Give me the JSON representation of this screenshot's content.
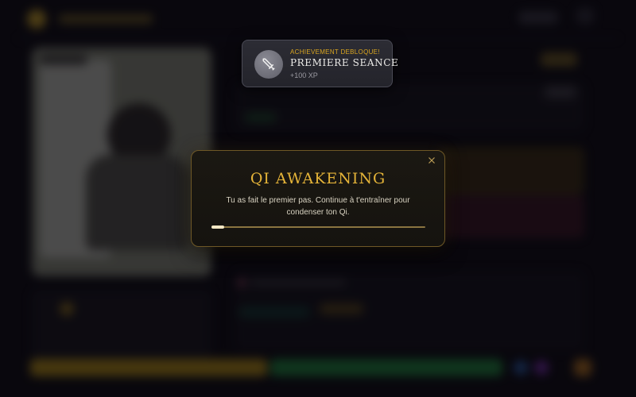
{
  "achievement_toast": {
    "kicker": "ACHIEVEMENT DEBLOQUE!",
    "title": "PREMIERE SEANCE",
    "xp": "+100 XP",
    "icon": "sword-icon"
  },
  "modal": {
    "title": "QI AWAKENING",
    "message": "Tu as fait le premier pas. Continue à t'entraîner pour condenser ton Qi.",
    "close_icon": "close-icon",
    "progress": 0.06
  },
  "colors": {
    "accent_gold": "#e4b338",
    "modal_border": "#6e5826",
    "toast_kicker": "#d9a520",
    "progress_track": "#8a7440",
    "progress_fill": "#f3e7c4"
  }
}
